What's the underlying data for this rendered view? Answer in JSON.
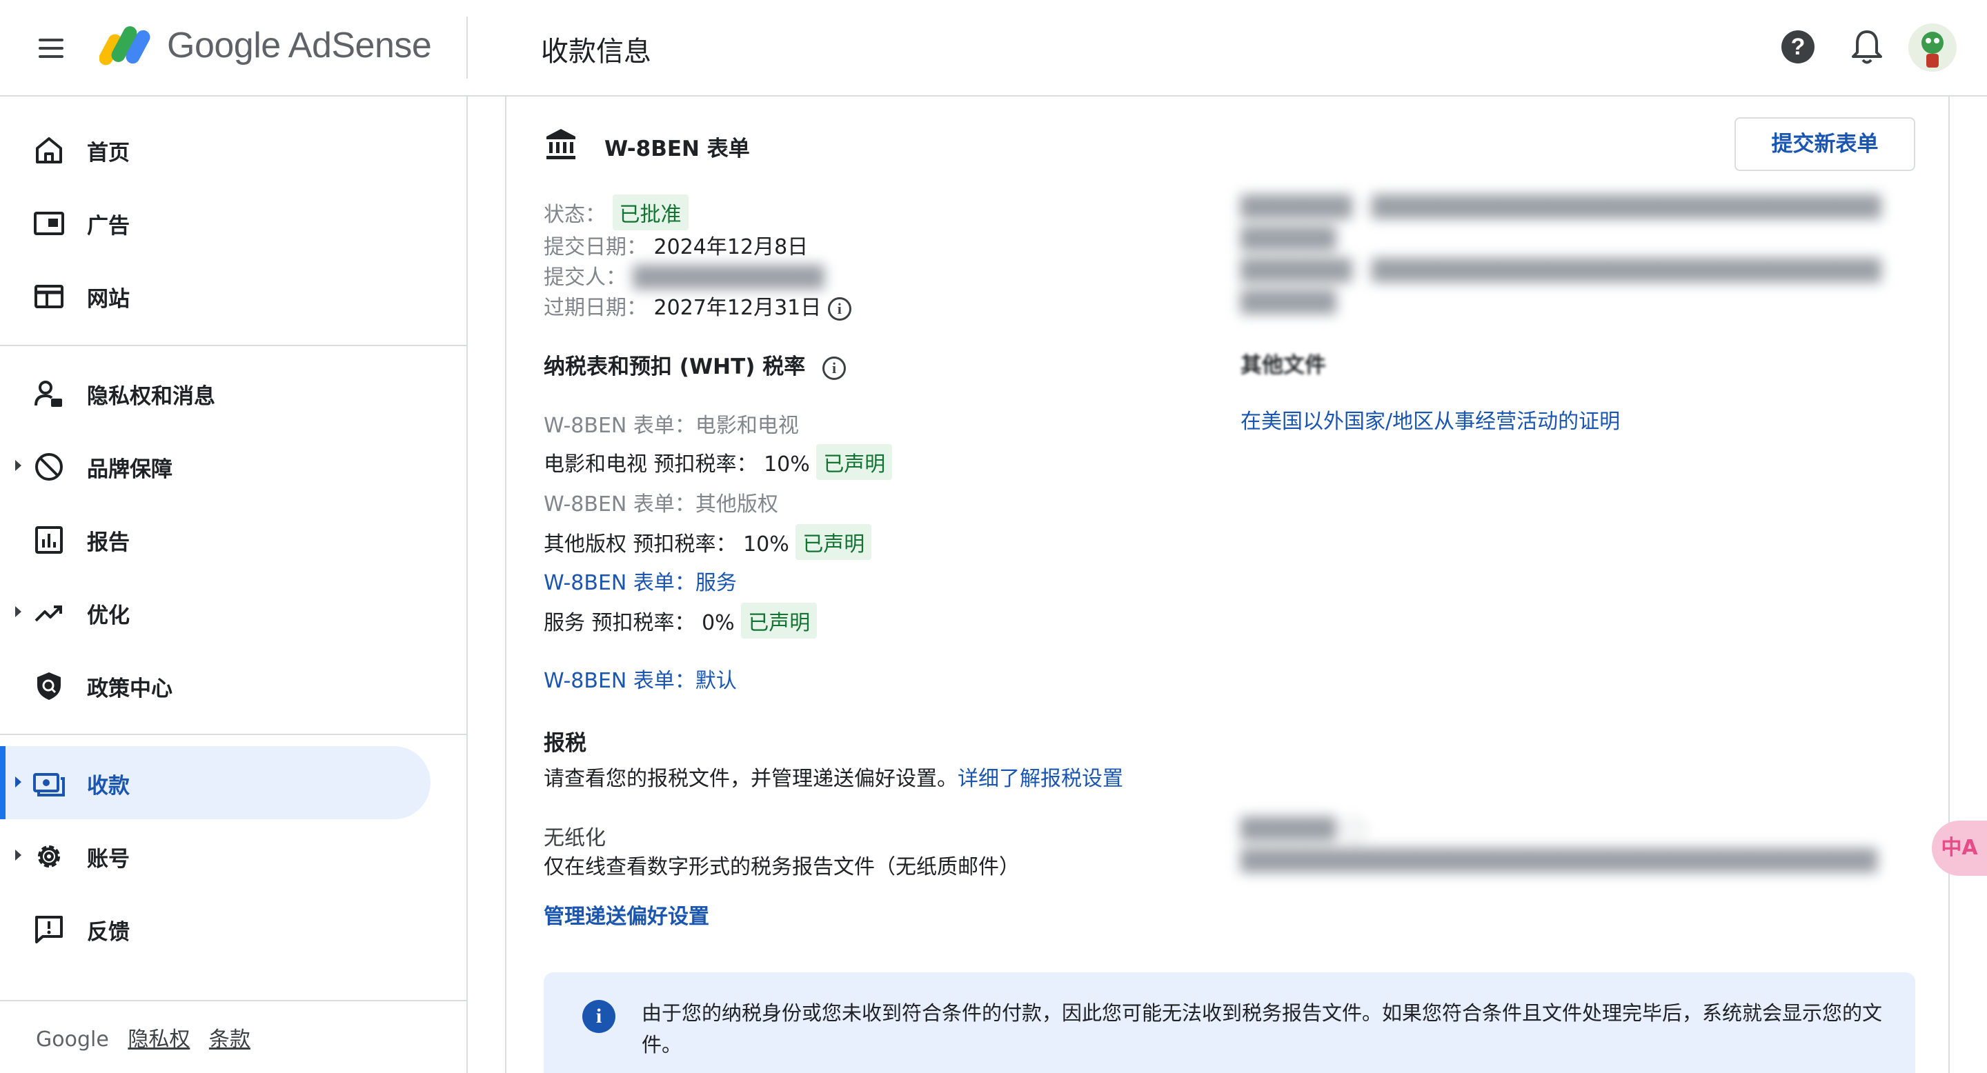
{
  "header": {
    "brand": "Google AdSense",
    "title": "收款信息",
    "help_icon": "help-icon",
    "bell_icon": "notifications-icon"
  },
  "sidebar": {
    "items": [
      {
        "label": "首页",
        "icon": "home-icon"
      },
      {
        "label": "广告",
        "icon": "ads-icon"
      },
      {
        "label": "网站",
        "icon": "sites-icon"
      },
      {
        "label": "隐私权和消息",
        "icon": "privacy-messaging-icon"
      },
      {
        "label": "品牌保障",
        "icon": "block-icon"
      },
      {
        "label": "报告",
        "icon": "reports-icon"
      },
      {
        "label": "优化",
        "icon": "trending-up-icon"
      },
      {
        "label": "政策中心",
        "icon": "shield-icon"
      },
      {
        "label": "收款",
        "icon": "payments-icon"
      },
      {
        "label": "账号",
        "icon": "settings-icon"
      },
      {
        "label": "反馈",
        "icon": "feedback-icon"
      }
    ],
    "active": "收款",
    "footer": {
      "google": "Google",
      "privacy": "隐私权",
      "terms": "条款"
    }
  },
  "card": {
    "title": "W-8BEN 表单",
    "submit_button": "提交新表单",
    "status_label": "状态：",
    "status_value": "已批准",
    "submitted_label": "提交日期：",
    "submitted_value": "2024年12月8日",
    "submitter_label": "提交人：",
    "submitter_value": "",
    "expiry_label": "过期日期：",
    "expiry_value": "2027年12月31日",
    "wht_title": "纳税表和预扣 (WHT) 税率",
    "rates": [
      {
        "form": "W-8BEN 表单：电影和电视",
        "rate": "电影和电视 预扣税率：  10%",
        "declared": "已声明"
      },
      {
        "form": "W-8BEN 表单：其他版权",
        "rate": "其他版权 预扣税率：  10%",
        "declared": "已声明"
      },
      {
        "form": "W-8BEN 表单：服务",
        "rate": "服务 预扣税率：  0%",
        "declared": "已声明"
      }
    ],
    "default_form": "W-8BEN 表单：默认",
    "other_docs_title": "其他文件",
    "other_docs_link": "在美国以外国家/地区从事经营活动的证明",
    "tax_title": "报税",
    "tax_desc": "请查看您的报税文件，并管理递送偏好设置。",
    "tax_learn_more": "详细了解报税设置",
    "paperless_title": "无纸化",
    "paperless_desc": "仅在线查看数字形式的税务报告文件（无纸质邮件）",
    "manage_link": "管理递送偏好设置",
    "notice": "由于您的纳税身份或您未收到符合条件的付款，因此您可能无法收到税务报告文件。如果您符合条件且文件处理完毕后，系统就会显示您的文件。"
  },
  "translate_fab": "中A",
  "colors": {
    "accent": "#1a56b0",
    "chip_bg": "#e6f4ea",
    "chip_text": "#137333",
    "active_bg": "#e8f0fe"
  }
}
